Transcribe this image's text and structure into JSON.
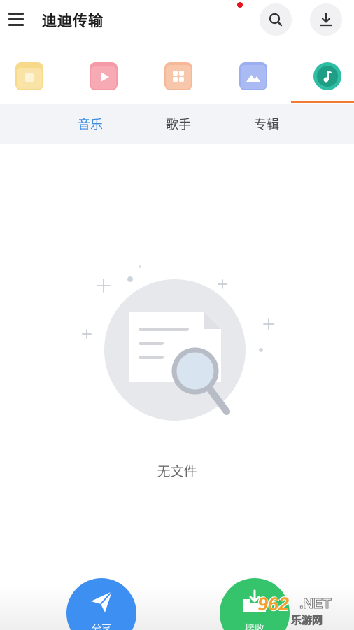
{
  "header": {
    "title": "迪迪传输",
    "menu_icon": "hamburger-menu-icon",
    "search_icon": "search-icon",
    "download_icon": "download-icon"
  },
  "category_tabs": [
    {
      "name": "file",
      "icon": "folder-icon",
      "color": "#f7d98a"
    },
    {
      "name": "video",
      "icon": "video-play-icon",
      "color": "#f59aa6"
    },
    {
      "name": "app",
      "icon": "app-grid-icon",
      "color": "#f6b896"
    },
    {
      "name": "image",
      "icon": "image-icon",
      "color": "#9aaef0"
    },
    {
      "name": "music",
      "icon": "music-note-icon",
      "color": "#2fbda4",
      "active": true
    }
  ],
  "sub_tabs": [
    {
      "label": "音乐",
      "active": true
    },
    {
      "label": "歌手",
      "active": false
    },
    {
      "label": "专辑",
      "active": false
    }
  ],
  "empty_state": {
    "text": "无文件",
    "icon": "no-file-search-illustration"
  },
  "bottom_actions": {
    "share_label": "分享",
    "receive_label": "接收"
  },
  "watermark": {
    "number": "962",
    "suffix": ".NET",
    "site": "乐游网"
  },
  "colors": {
    "accent_blue": "#3d8de0",
    "tab_underline": "#f07a36",
    "share_button": "#3d8ff2",
    "receive_button": "#35c46c",
    "notification_dot": "#e8121a"
  }
}
